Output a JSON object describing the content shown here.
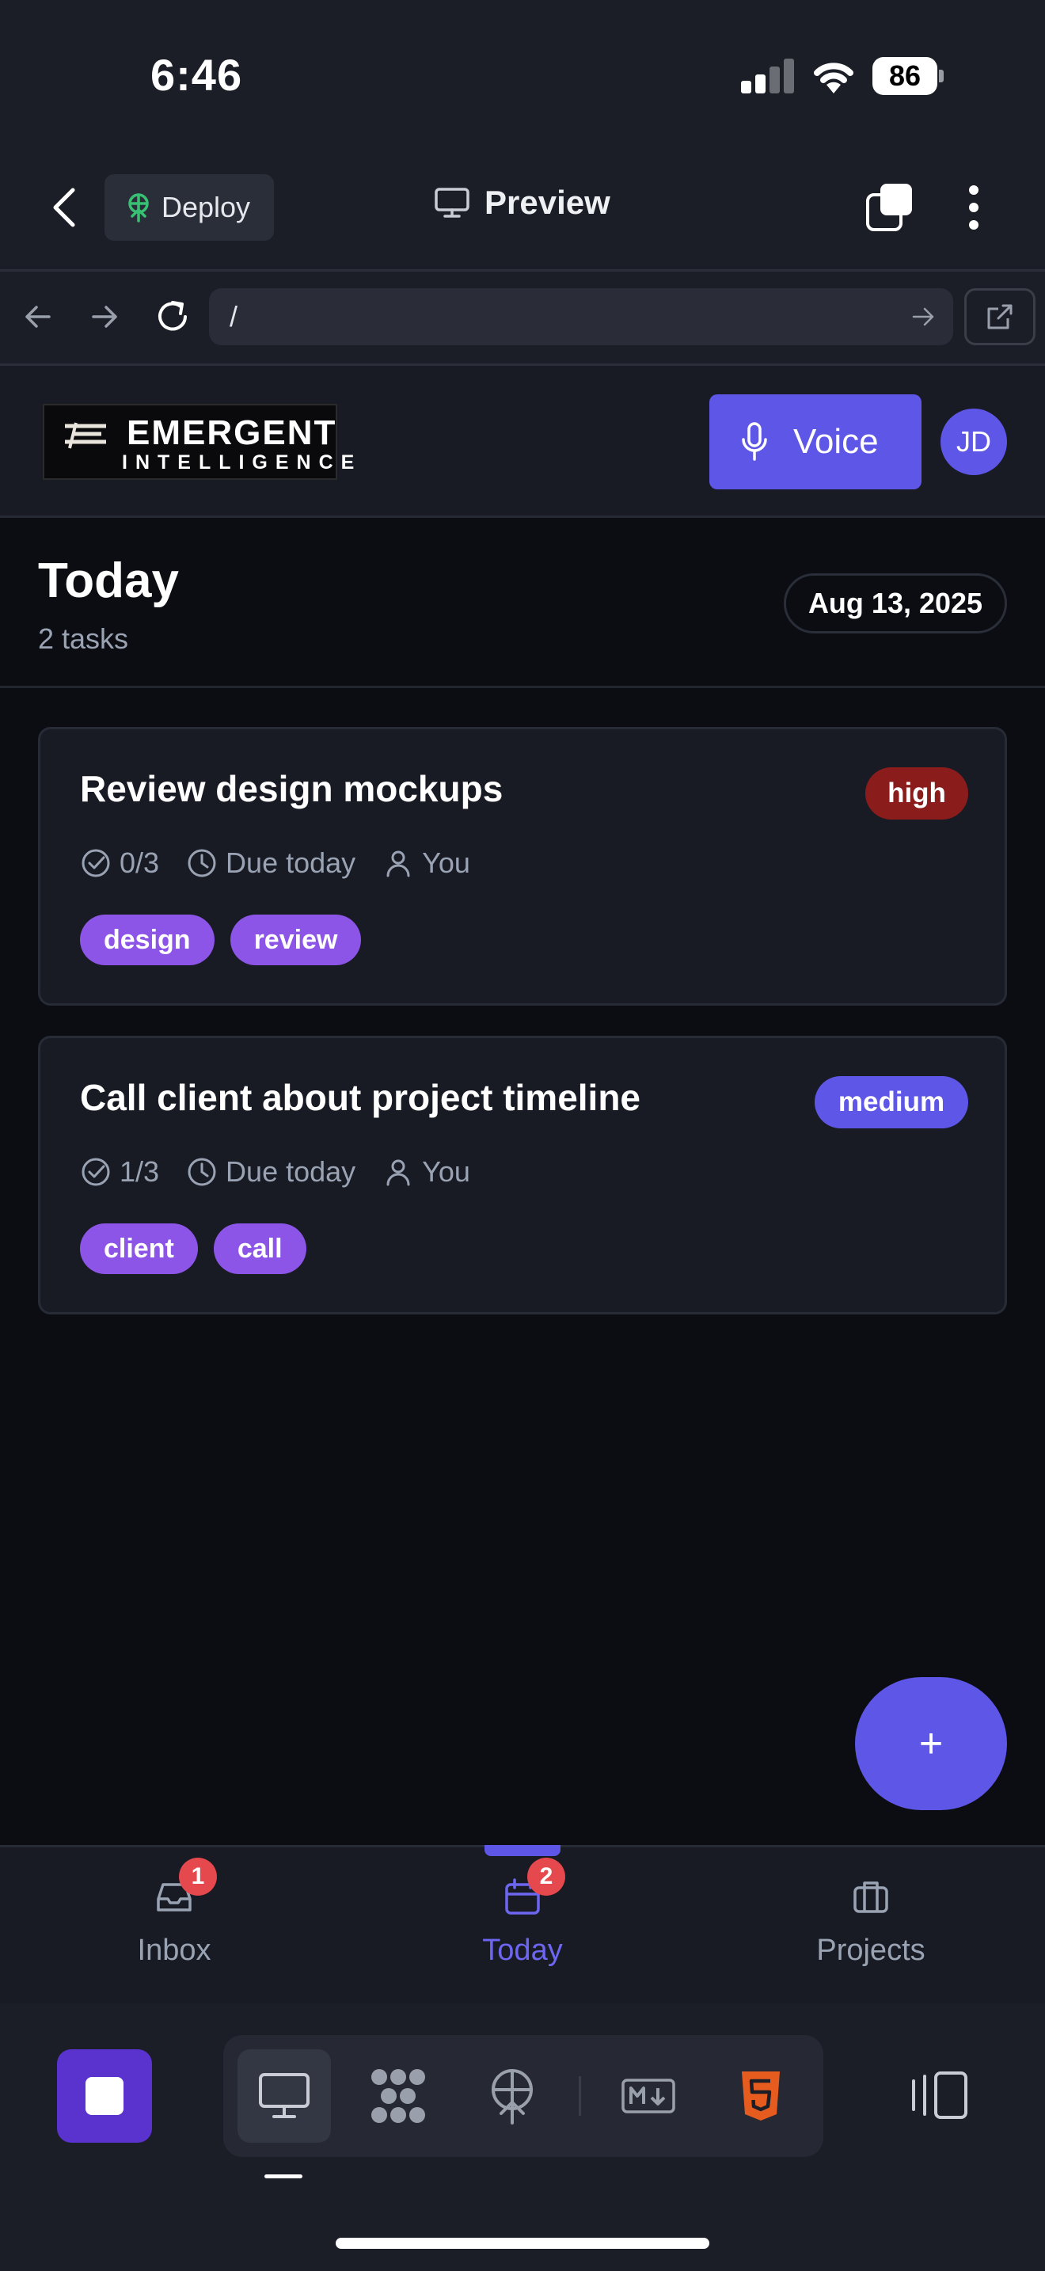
{
  "status_bar": {
    "time": "6:46",
    "battery": "86"
  },
  "top_bar": {
    "deploy_label": "Deploy",
    "preview_label": "Preview"
  },
  "browser": {
    "url": "/"
  },
  "app_header": {
    "logo_line1": "EMERGENT",
    "logo_line2": "INTELLIGENCE",
    "voice_label": "Voice",
    "avatar_initials": "JD"
  },
  "today": {
    "title": "Today",
    "task_count": "2 tasks",
    "date": "Aug 13, 2025"
  },
  "tasks": [
    {
      "title": "Review design mockups",
      "priority": "high",
      "subtasks": "0/3",
      "due": "Due today",
      "assignee": "You",
      "tags": [
        "design",
        "review"
      ]
    },
    {
      "title": "Call client about project timeline",
      "priority": "medium",
      "subtasks": "1/3",
      "due": "Due today",
      "assignee": "You",
      "tags": [
        "client",
        "call"
      ]
    }
  ],
  "fab": {
    "label": "+"
  },
  "bottom_nav": {
    "items": [
      {
        "label": "Inbox",
        "badge": "1",
        "active": false
      },
      {
        "label": "Today",
        "badge": "2",
        "active": true
      },
      {
        "label": "Projects",
        "badge": "",
        "active": false
      }
    ]
  },
  "colors": {
    "accent": "#5e56e6",
    "tag": "#8c55e8",
    "priority_high": "#8b1c1c",
    "priority_medium": "#5e56e6",
    "badge_red": "#e5484d"
  },
  "ide_toolbar": {
    "tools": [
      "desktop-preview-icon",
      "apps-grid-icon",
      "deploy-globe-icon",
      "markdown-icon",
      "html5-icon"
    ]
  }
}
